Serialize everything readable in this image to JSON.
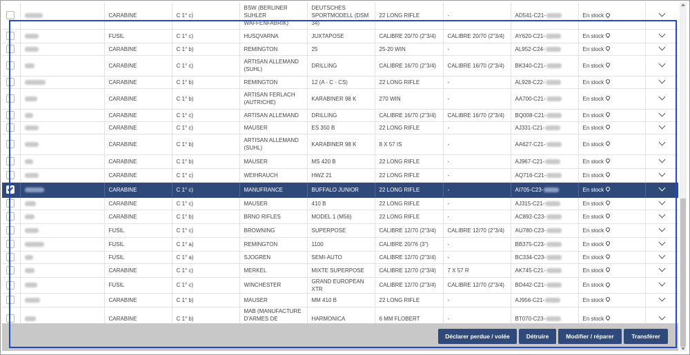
{
  "table": {
    "rows": [
      {
        "type": "CARABINE",
        "cat": "C 1° c)",
        "fab": "BSW (BERLINER SUHLER WAFFENFABRIK)",
        "model": "DEUTSCHES SPORTMODELL (DSM 34)",
        "cal1": "22 LONG RIFLE",
        "cal2": "-",
        "ref": "AD541-C21-",
        "stock": "En stock",
        "checked": false,
        "selected": false
      },
      {
        "type": "FUSIL",
        "cat": "C 1° c)",
        "fab": "HUSQVARNA",
        "model": "JUXTAPOSE",
        "cal1": "CALIBRE 20/70 (2\"3/4)",
        "cal2": "CALIBRE 20/70 (2\"3/4)",
        "ref": "AY620-C21-",
        "stock": "En stock",
        "checked": false,
        "selected": false
      },
      {
        "type": "CARABINE",
        "cat": "C 1° b)",
        "fab": "REMINGTON",
        "model": "25",
        "cal1": "25-20 WIN",
        "cal2": "-",
        "ref": "AL952-C24-",
        "stock": "En stock",
        "checked": false,
        "selected": false
      },
      {
        "type": "CARABINE",
        "cat": "C 1° c)",
        "fab": "ARTISAN ALLEMAND (SUHL)",
        "model": "DRILLING",
        "cal1": "CALIBRE 16/70 (2\"3/4)",
        "cal2": "CALIBRE 16/70 (2\"3/4)",
        "ref": "BK340-C21-",
        "stock": "En stock",
        "checked": false,
        "selected": false
      },
      {
        "type": "CARABINE",
        "cat": "C 1° b)",
        "fab": "REMINGTON",
        "model": "12 (A - C - CS)",
        "cal1": "22 LONG RIFLE",
        "cal2": "-",
        "ref": "AL928-C22-",
        "stock": "En stock",
        "checked": false,
        "selected": false
      },
      {
        "type": "CARABINE",
        "cat": "C 1° b)",
        "fab": "ARTISAN FERLACH (AUTRICHE)",
        "model": "KARABINER 98 K",
        "cal1": "270 WIN",
        "cal2": "-",
        "ref": "AA700-C21-",
        "stock": "En stock",
        "checked": false,
        "selected": false
      },
      {
        "type": "CARABINE",
        "cat": "C 1° c)",
        "fab": "ARTISAN ALLEMAND",
        "model": "DRILLING",
        "cal1": "CALIBRE 16/70 (2\"3/4)",
        "cal2": "CALIBRE 16/70 (2\"3/4)",
        "ref": "BQ008-C21-",
        "stock": "En stock",
        "checked": false,
        "selected": false
      },
      {
        "type": "CARABINE",
        "cat": "C 1° c)",
        "fab": "MAUSER",
        "model": "ES 350 B",
        "cal1": "22 LONG RIFLE",
        "cal2": "-",
        "ref": "AJ331-C21-",
        "stock": "En stock",
        "checked": false,
        "selected": false
      },
      {
        "type": "CARABINE",
        "cat": "C 1° b)",
        "fab": "ARTISAN ALLEMAND (SUHL)",
        "model": "KARABINER 98 K",
        "cal1": "8 X 57 IS",
        "cal2": "-",
        "ref": "AA627-C21-",
        "stock": "En stock",
        "checked": false,
        "selected": false
      },
      {
        "type": "CARABINE",
        "cat": "C 1° b)",
        "fab": "MAUSER",
        "model": "MS 420 B",
        "cal1": "22 LONG RIFLE",
        "cal2": "-",
        "ref": "AJ967-C21-",
        "stock": "En stock",
        "checked": false,
        "selected": false
      },
      {
        "type": "CARABINE",
        "cat": "C 1° c)",
        "fab": "WEIHRAUCH",
        "model": "HWZ 21",
        "cal1": "22 LONG RIFLE",
        "cal2": "-",
        "ref": "AQ716-C21-",
        "stock": "En stock",
        "checked": false,
        "selected": false
      },
      {
        "type": "CARABINE",
        "cat": "C 1° c)",
        "fab": "MANUFRANCE",
        "model": "BUFFALO JUNIOR",
        "cal1": "22 LONG RIFLE",
        "cal2": "-",
        "ref": "AI705-C23-",
        "stock": "En stock",
        "checked": true,
        "selected": true
      },
      {
        "type": "CARABINE",
        "cat": "C 1° c)",
        "fab": "MAUSER",
        "model": "410 B",
        "cal1": "22 LONG RIFLE",
        "cal2": "-",
        "ref": "AJ315-C21-",
        "stock": "En stock",
        "checked": false,
        "selected": false
      },
      {
        "type": "CARABINE",
        "cat": "C 1° b)",
        "fab": "BRNO RIFLES",
        "model": "MODEL 1 (M56)",
        "cal1": "22 LONG RIFLE",
        "cal2": "-",
        "ref": "AC892-C23-",
        "stock": "En stock",
        "checked": false,
        "selected": false
      },
      {
        "type": "FUSIL",
        "cat": "C 1° c)",
        "fab": "BROWNING",
        "model": "SUPERPOSE",
        "cal1": "CALIBRE 12/70 (2\"3/4)",
        "cal2": "CALIBRE 12/70 (2\"3/4)",
        "ref": "AU780-C23-",
        "stock": "En stock",
        "checked": false,
        "selected": false
      },
      {
        "type": "FUSIL",
        "cat": "C 1° a)",
        "fab": "REMINGTON",
        "model": "1100",
        "cal1": "CALIBRE 20/76 (3\")",
        "cal2": "-",
        "ref": "BB375-C23-",
        "stock": "En stock",
        "checked": false,
        "selected": false
      },
      {
        "type": "FUSIL",
        "cat": "C 1° a)",
        "fab": "SJOGREN",
        "model": "SEMI-AUTO",
        "cal1": "CALIBRE 12/70 (2\"3/4)",
        "cal2": "-",
        "ref": "BC334-C23-",
        "stock": "En stock",
        "checked": false,
        "selected": false
      },
      {
        "type": "CARABINE",
        "cat": "C 1° c)",
        "fab": "MERKEL",
        "model": "MIXTE SUPERPOSE",
        "cal1": "CALIBRE 12/70 (2\"3/4)",
        "cal2": "7 X 57 R",
        "ref": "AK745-C21-",
        "stock": "En stock",
        "checked": false,
        "selected": false
      },
      {
        "type": "FUSIL",
        "cat": "C 1° c)",
        "fab": "WINCHESTER",
        "model": "GRAND EUROPEAN XTR",
        "cal1": "CALIBRE 12/70 (2\"3/4)",
        "cal2": "CALIBRE 12/70 (2\"3/4)",
        "ref": "BD442-C21-",
        "stock": "En stock",
        "checked": false,
        "selected": false
      },
      {
        "type": "CARABINE",
        "cat": "C 1° b)",
        "fab": "MAUSER",
        "model": "MM 410 B",
        "cal1": "22 LONG RIFLE",
        "cal2": "-",
        "ref": "AJ956-C21-",
        "stock": "En stock",
        "checked": false,
        "selected": false
      },
      {
        "type": "CARABINE",
        "cat": "C 1° b)",
        "fab": "MAB (MANUFACTURE D'ARMES DE BAYONNE)",
        "model": "HARMONICA",
        "cal1": "6 MM FLOBERT",
        "cal2": "-",
        "ref": "BT070-C23-",
        "stock": "En stock",
        "checked": false,
        "selected": false
      }
    ]
  },
  "footer": {
    "declare_label": "Déclarer perdue / volée",
    "destroy_label": "Détruire",
    "modify_label": "Modifier / réparer",
    "transfer_label": "Transférer"
  },
  "colors": {
    "accent": "#2f4a7a",
    "highlight": "#1f45d9",
    "footer_bg": "#c8c8c8"
  },
  "icons": {
    "location": "location-pin-icon",
    "expand": "chevron-down-icon",
    "select": "checkbox"
  }
}
